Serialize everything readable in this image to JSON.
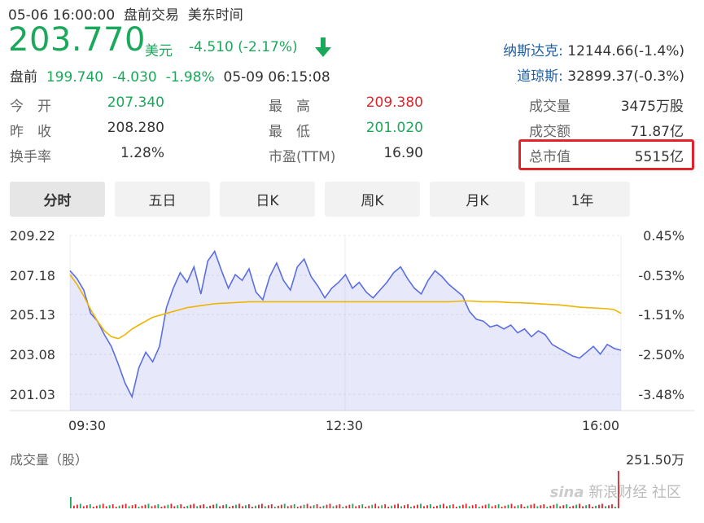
{
  "header": {
    "datetime": "05-06 16:00:00",
    "session": "盘前交易",
    "timezone": "美东时间",
    "price": "203.770",
    "currency": "美元",
    "change": "-4.510 (-2.17%)",
    "trend_icon": "arrow-down-icon"
  },
  "indices": [
    {
      "name": "纳斯达克:",
      "value": "12144.66(-1.4%)"
    },
    {
      "name": "道琼斯:",
      "value": "32899.37(-0.3%)"
    }
  ],
  "premarket": {
    "label": "盘前",
    "price": "199.740",
    "change": "-4.030",
    "percent": "-1.98%",
    "time": "05-09 06:15:08"
  },
  "stats": {
    "open": {
      "label": "今　开",
      "value": "207.340"
    },
    "prev_close": {
      "label": "昨　收",
      "value": "208.280"
    },
    "turnover_rate": {
      "label": "换手率",
      "value": "1.28%"
    },
    "high": {
      "label": "最　高",
      "value": "209.380"
    },
    "low": {
      "label": "最　低",
      "value": "201.020"
    },
    "pe": {
      "label": "市盈(TTM)",
      "value": "16.90"
    },
    "volume": {
      "label": "成交量",
      "value": "3475万股"
    },
    "amount": {
      "label": "成交额",
      "value": "71.87亿"
    },
    "market_cap": {
      "label": "总市值",
      "value": "5515亿"
    }
  },
  "tabs": [
    "分时",
    "五日",
    "日K",
    "周K",
    "月K",
    "1年"
  ],
  "active_tab": 0,
  "chart_data": {
    "type": "line",
    "y_left_ticks": [
      "209.22",
      "207.18",
      "205.13",
      "203.08",
      "201.03"
    ],
    "y_right_ticks": [
      "0.45%",
      "-0.53%",
      "-1.51%",
      "-2.50%",
      "-3.48%"
    ],
    "x_ticks": [
      "09:30",
      "12:30",
      "16:00"
    ],
    "ylim": [
      201.03,
      209.22
    ],
    "series": [
      {
        "color": "#5b6ee1",
        "values": [
          207.4,
          207.0,
          206.4,
          205.2,
          204.8,
          204.1,
          203.5,
          202.6,
          201.6,
          200.9,
          202.4,
          203.2,
          202.7,
          203.5,
          205.5,
          206.5,
          207.3,
          206.8,
          207.6,
          206.2,
          207.9,
          208.4,
          207.4,
          206.5,
          207.2,
          206.9,
          207.5,
          206.3,
          205.9,
          207.1,
          207.8,
          206.9,
          206.4,
          207.6,
          208.0,
          207.1,
          206.6,
          206.0,
          206.5,
          206.8,
          207.2,
          206.5,
          206.8,
          206.3,
          206.0,
          206.4,
          206.8,
          207.3,
          207.6,
          207.0,
          206.5,
          206.2,
          206.9,
          207.4,
          207.1,
          206.7,
          206.4,
          206.1,
          205.3,
          204.9,
          204.8,
          204.5,
          204.6,
          204.4,
          204.6,
          204.2,
          204.4,
          204.0,
          204.3,
          204.1,
          203.6,
          203.4,
          203.2,
          203.0,
          202.9,
          203.2,
          203.5,
          203.1,
          203.6,
          203.4,
          203.3
        ]
      },
      {
        "color": "#f0b400",
        "values": [
          207.2,
          206.7,
          206.1,
          205.4,
          204.8,
          204.3,
          204.0,
          203.9,
          204.1,
          204.4,
          204.6,
          204.8,
          205.0,
          205.1,
          205.2,
          205.3,
          205.4,
          205.5,
          205.55,
          205.6,
          205.65,
          205.7,
          205.72,
          205.74,
          205.76,
          205.78,
          205.8,
          205.8,
          205.8,
          205.8,
          205.8,
          205.8,
          205.8,
          205.8,
          205.8,
          205.8,
          205.8,
          205.8,
          205.8,
          205.8,
          205.8,
          205.8,
          205.8,
          205.8,
          205.8,
          205.8,
          205.8,
          205.8,
          205.8,
          205.8,
          205.8,
          205.8,
          205.8,
          205.8,
          205.8,
          205.8,
          205.82,
          205.84,
          205.84,
          205.82,
          205.8,
          205.8,
          205.8,
          205.78,
          205.76,
          205.75,
          205.74,
          205.72,
          205.7,
          205.68,
          205.66,
          205.64,
          205.6,
          205.56,
          205.52,
          205.5,
          205.48,
          205.46,
          205.44,
          205.4,
          205.2
        ]
      }
    ],
    "volume_max": "251.50万",
    "volume_title": "成交量（股）"
  },
  "watermark": "新浪财经 社区"
}
